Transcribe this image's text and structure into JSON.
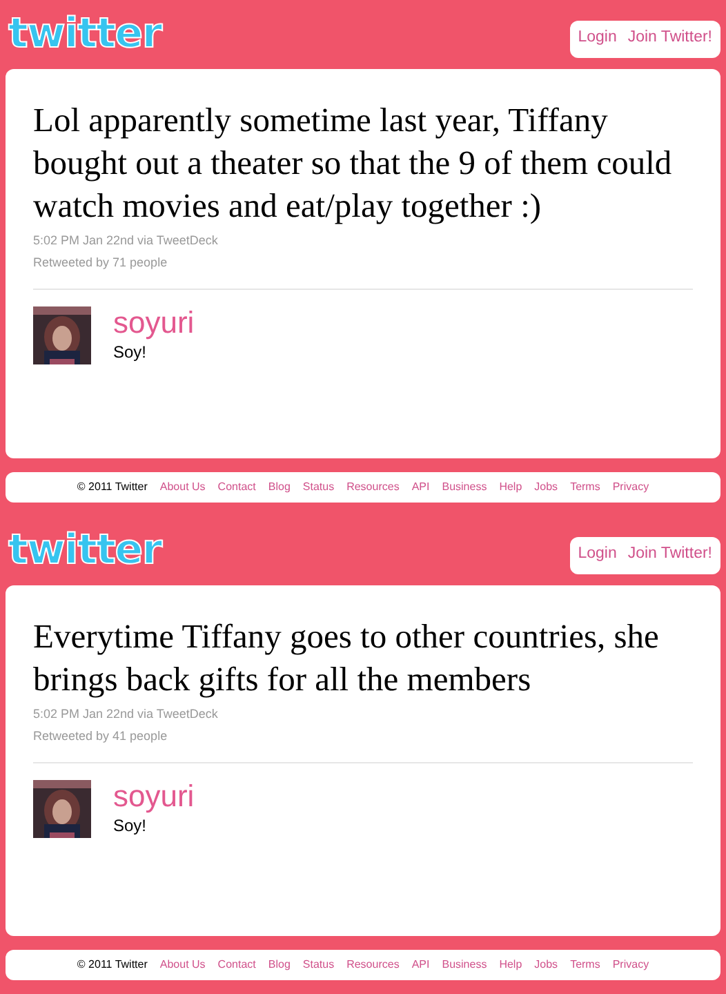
{
  "pages": [
    {
      "logo": "twitter",
      "header_links": [
        "Login",
        "Join Twitter!"
      ],
      "tweet": {
        "text": "Lol apparently sometime last year, Tiffany bought out a theater so that the 9 of them could watch movies and eat/play together :)",
        "meta": "5:02 PM Jan 22nd via TweetDeck",
        "retweets": "Retweeted by 71 people"
      },
      "user": {
        "name": "soyuri",
        "bio": "Soy!"
      },
      "footer": {
        "copyright": "© 2011 Twitter",
        "links": [
          "About Us",
          "Contact",
          "Blog",
          "Status",
          "Resources",
          "API",
          "Business",
          "Help",
          "Jobs",
          "Terms",
          "Privacy"
        ]
      }
    },
    {
      "logo": "twitter",
      "header_links": [
        "Login",
        "Join Twitter!"
      ],
      "tweet": {
        "text": "Everytime Tiffany goes to other countries, she brings back gifts for all the members",
        "meta": "5:02 PM Jan 22nd via TweetDeck",
        "retweets": "Retweeted by 41 people"
      },
      "user": {
        "name": "soyuri",
        "bio": "Soy!"
      },
      "footer": {
        "copyright": "© 2011 Twitter",
        "links": [
          "About Us",
          "Contact",
          "Blog",
          "Status",
          "Resources",
          "API",
          "Business",
          "Help",
          "Jobs",
          "Terms",
          "Privacy"
        ]
      }
    }
  ]
}
